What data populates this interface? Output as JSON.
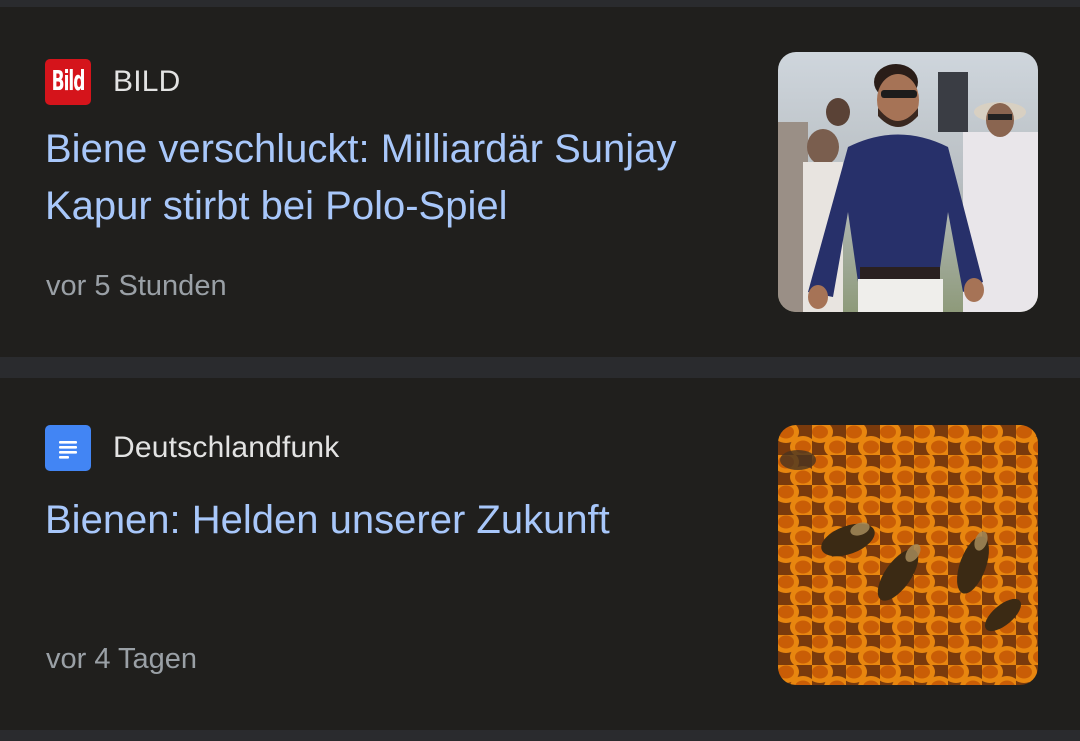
{
  "articles": [
    {
      "source": "BILD",
      "source_icon": "bild-logo-icon",
      "source_icon_text": "Bild",
      "headline": "Biene verschluckt: Milliardär Sunjay Kapur stirbt bei Polo-Spiel",
      "time": "vor 5 Stunden",
      "thumbnail": "man-in-blue-shirt-photo"
    },
    {
      "source": "Deutschlandfunk",
      "source_icon": "google-news-doc-icon",
      "headline": "Bienen: Helden unserer Zukunft",
      "time": "vor 4 Tagen",
      "thumbnail": "bees-on-honeycomb-photo"
    }
  ],
  "colors": {
    "background": "#201f1d",
    "divider": "#2a2b2e",
    "headline": "#a8c7fa",
    "source": "#e3e3e3",
    "timestamp": "#9aa0a6",
    "bild_red": "#d5141b",
    "dlf_blue": "#4285f4"
  }
}
